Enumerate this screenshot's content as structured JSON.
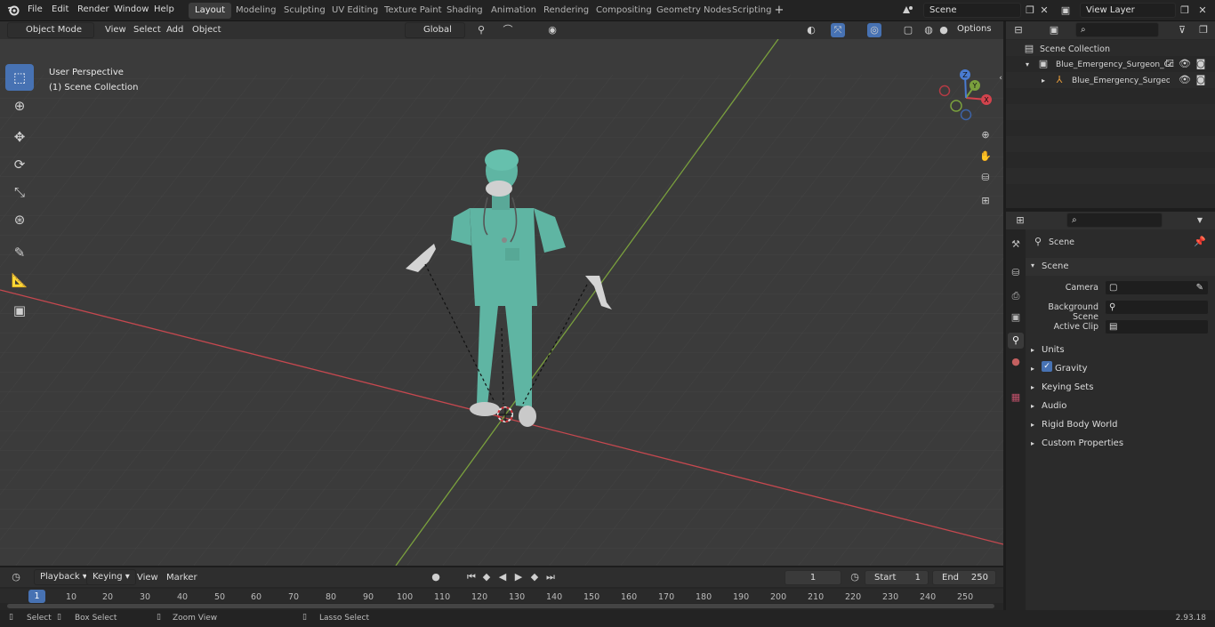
{
  "app": {
    "menus": [
      "File",
      "Edit",
      "Render",
      "Window",
      "Help"
    ],
    "workspaces": [
      "Layout",
      "Modeling",
      "Sculpting",
      "UV Editing",
      "Texture Paint",
      "Shading",
      "Animation",
      "Rendering",
      "Compositing",
      "Geometry Nodes",
      "Scripting"
    ],
    "active_workspace": "Layout",
    "scene_field": "Scene",
    "view_layer_field": "View Layer"
  },
  "viewport_header": {
    "mode": "Object Mode",
    "menus": [
      "View",
      "Select",
      "Add",
      "Object"
    ],
    "orientation": "Global",
    "options": "Options"
  },
  "viewport": {
    "perspective_label": "User Perspective",
    "collection_label": "(1) Scene Collection",
    "gizmo_axes": [
      "X",
      "Y",
      "Z"
    ]
  },
  "outliner": {
    "root": "Scene Collection",
    "items": [
      {
        "label": "Blue_Emergency_Surgeon_Cc"
      },
      {
        "label": "Blue_Emergency_Surgeo"
      }
    ]
  },
  "properties": {
    "context": "Scene",
    "panel_title": "Scene",
    "fields": [
      {
        "label": "Camera"
      },
      {
        "label": "Background Scene"
      },
      {
        "label": "Active Clip"
      }
    ],
    "sections": [
      "Units",
      "Gravity",
      "Keying Sets",
      "Audio",
      "Rigid Body World",
      "Custom Properties"
    ],
    "gravity_checked": true
  },
  "timeline": {
    "menus": [
      "Playback",
      "Keying",
      "View",
      "Marker"
    ],
    "current_frame": "1",
    "start_label": "Start",
    "start_value": "1",
    "end_label": "End",
    "end_value": "250",
    "ticks": [
      "1",
      "10",
      "20",
      "30",
      "40",
      "50",
      "60",
      "70",
      "80",
      "90",
      "100",
      "110",
      "120",
      "130",
      "140",
      "150",
      "160",
      "170",
      "180",
      "190",
      "200",
      "210",
      "220",
      "230",
      "240",
      "250"
    ]
  },
  "statusbar": {
    "items": [
      "Select",
      "Box Select",
      "Zoom View",
      "Lasso Select"
    ],
    "version": "2.93.18"
  },
  "colors": {
    "accent": "#4772b3",
    "x_axis": "#c5484f",
    "y_axis": "#7aa03d",
    "surgeon": "#5fb5a3"
  }
}
